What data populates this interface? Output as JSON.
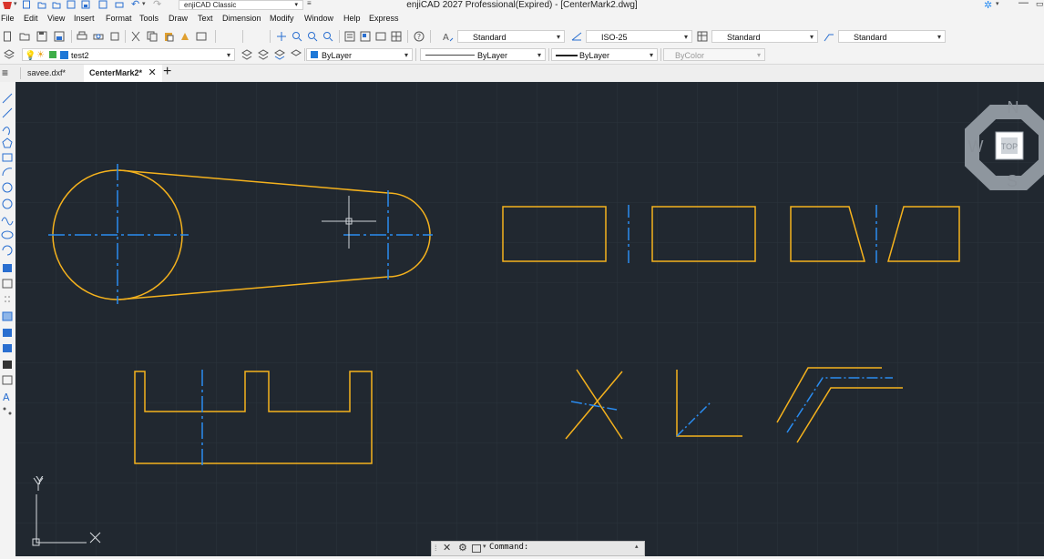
{
  "title_bar": {
    "workspace": "enjiCAD Classic",
    "window_title": "enjiCAD 2027 Professional(Expired) - [CenterMark2.dwg]"
  },
  "menu": {
    "items": [
      "File",
      "Edit",
      "View",
      "Insert",
      "Format",
      "Tools",
      "Draw",
      "Text",
      "Dimension",
      "Modify",
      "Window",
      "Help",
      "Express"
    ]
  },
  "toolbar": {
    "text_style": "Standard",
    "dim_style": "ISO-25",
    "table_style": "Standard",
    "multileader_style": "Standard",
    "layer": "test2",
    "color": "ByLayer",
    "linetype": "ByLayer",
    "lineweight": "ByLayer",
    "plot_style": "ByColor"
  },
  "tabs": [
    {
      "label": "savee.dxf*",
      "active": false
    },
    {
      "label": "CenterMark2*",
      "active": true
    }
  ],
  "viewcube": {
    "north": "N",
    "south": "S",
    "west": "W",
    "face": "TOP"
  },
  "ucs": {
    "x": "X",
    "y": "Y"
  },
  "command_line": {
    "prompt": "Command:"
  },
  "colors": {
    "canvas": "#212830",
    "geometry": "#f5b21d",
    "center_lines": "#2a8cf0",
    "grid": "#2b333c"
  }
}
